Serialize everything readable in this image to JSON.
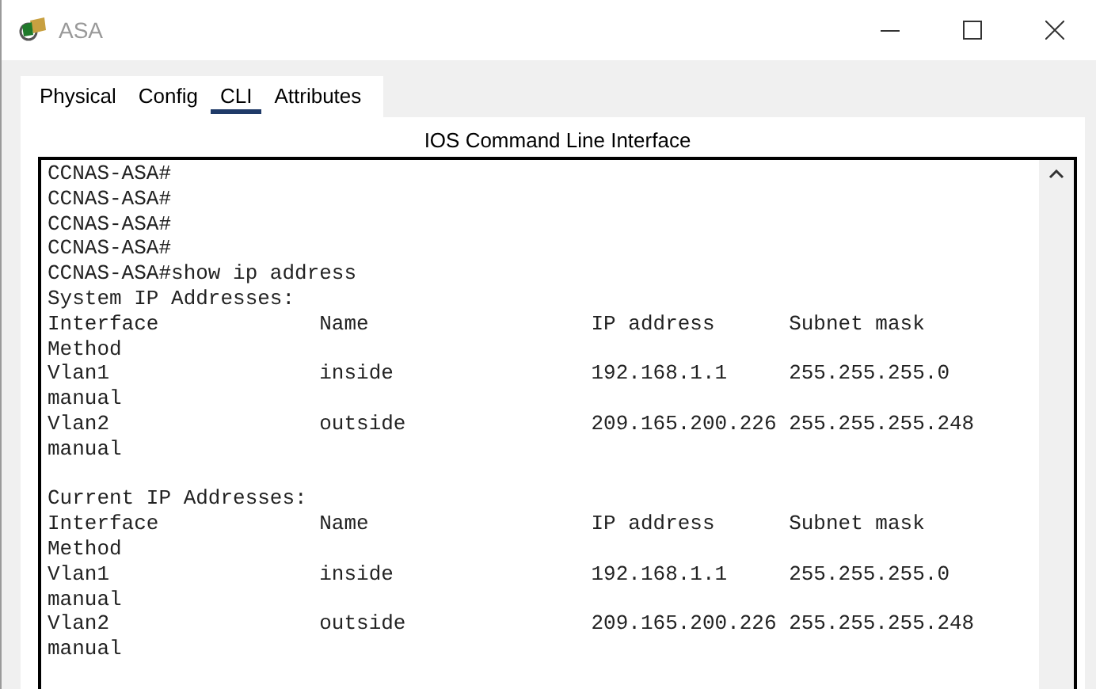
{
  "window": {
    "title": "ASA"
  },
  "tabs": [
    {
      "label": "Physical",
      "selected": false
    },
    {
      "label": "Config",
      "selected": false
    },
    {
      "label": "CLI",
      "selected": true
    },
    {
      "label": "Attributes",
      "selected": false
    }
  ],
  "cli": {
    "heading": "IOS Command Line Interface",
    "blocks": [
      [
        "CCNAS-ASA#",
        "CCNAS-ASA#",
        "CCNAS-ASA#",
        "CCNAS-ASA#",
        "CCNAS-ASA#show ip address",
        "System IP Addresses:",
        "Interface             Name                  IP address      Subnet mask",
        "Method",
        "Vlan1                 inside                192.168.1.1     255.255.255.0",
        "manual",
        "Vlan2                 outside               209.165.200.226 255.255.255.248",
        "manual"
      ],
      [
        "Current IP Addresses:",
        "Interface             Name                  IP address      Subnet mask",
        "Method",
        "Vlan1                 inside                192.168.1.1     255.255.255.0",
        "manual",
        "Vlan2                 outside               209.165.200.226 255.255.255.248",
        "manual"
      ]
    ]
  }
}
